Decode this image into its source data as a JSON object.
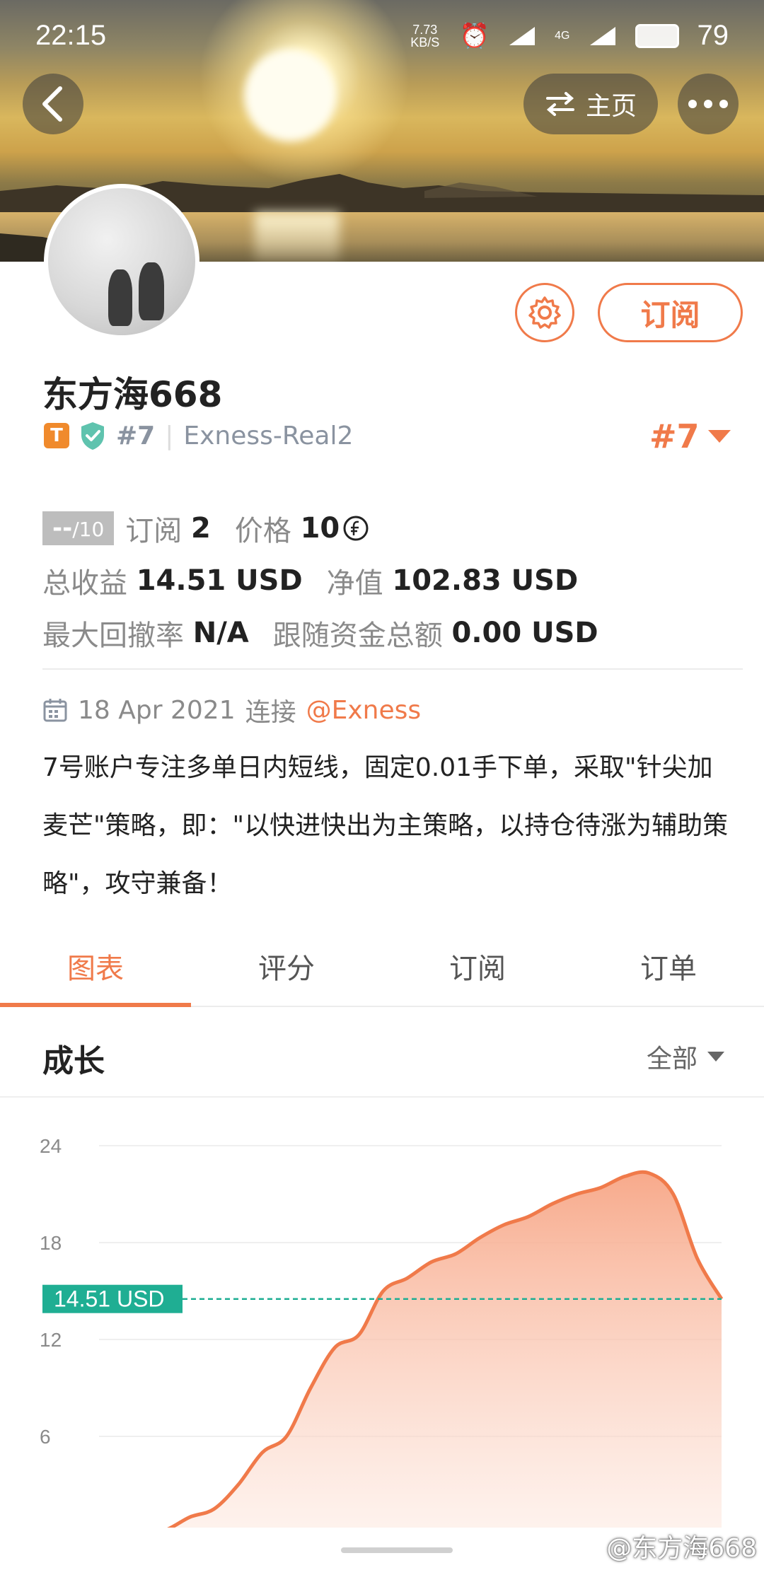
{
  "status_bar": {
    "time": "22:15",
    "net_speed": "7.73 KB/S",
    "network": "4G",
    "battery": "79"
  },
  "header": {
    "home_label": "主页"
  },
  "profile": {
    "name": "东方海668",
    "badge_letter": "T",
    "rank": "#7",
    "server": "Exness-Real2",
    "rank_right": "#7",
    "subscribe_label": "订阅"
  },
  "stats": {
    "score": "--",
    "score_max": "/10",
    "subscriptions_label": "订阅",
    "subscriptions": "2",
    "price_label": "价格",
    "price": "10",
    "total_profit_label": "总收益",
    "total_profit": "14.51 USD",
    "equity_label": "净值",
    "equity": "102.83 USD",
    "max_drawdown_label": "最大回撤率",
    "max_drawdown": "N/A",
    "follow_funds_label": "跟随资金总额",
    "follow_funds": "0.00 USD"
  },
  "connection": {
    "date": "18 Apr 2021",
    "connect_label": "连接",
    "broker": "@Exness"
  },
  "description": "7号账户专注多单日内短线，固定0.01手下单，采取\"针尖加麦芒\"策略，即：\"以快进快出为主策略，以持仓待涨为辅助策略\"，攻守兼备！",
  "tabs": [
    {
      "label": "图表",
      "active": true
    },
    {
      "label": "评分",
      "active": false
    },
    {
      "label": "订阅",
      "active": false
    },
    {
      "label": "订单",
      "active": false
    }
  ],
  "section": {
    "title": "成长",
    "filter": "全部"
  },
  "chart_data": {
    "type": "area",
    "title": "成长",
    "xlabel": "",
    "ylabel": "",
    "ylim": [
      0,
      24
    ],
    "yticks": [
      24,
      18,
      12,
      6
    ],
    "current_value_label": "14.51 USD",
    "current_value": 14.51,
    "x": [
      0,
      1,
      2,
      3,
      4,
      5,
      6,
      7,
      8,
      9,
      10,
      11,
      12,
      13,
      14,
      15,
      16,
      17,
      18,
      19,
      20,
      21,
      22,
      23,
      24
    ],
    "values": [
      0.0,
      0.2,
      1.0,
      1.5,
      3.0,
      5.0,
      6.0,
      9.0,
      11.5,
      12.3,
      15.0,
      15.8,
      16.8,
      17.3,
      18.3,
      19.1,
      19.6,
      20.4,
      21.0,
      21.4,
      22.1,
      22.3,
      21.0,
      17.0,
      14.51
    ],
    "colors": {
      "line": "#f07a4a",
      "fill": "#f9b99c",
      "marker": "#1fae93"
    }
  },
  "watermark": "@东方海668"
}
